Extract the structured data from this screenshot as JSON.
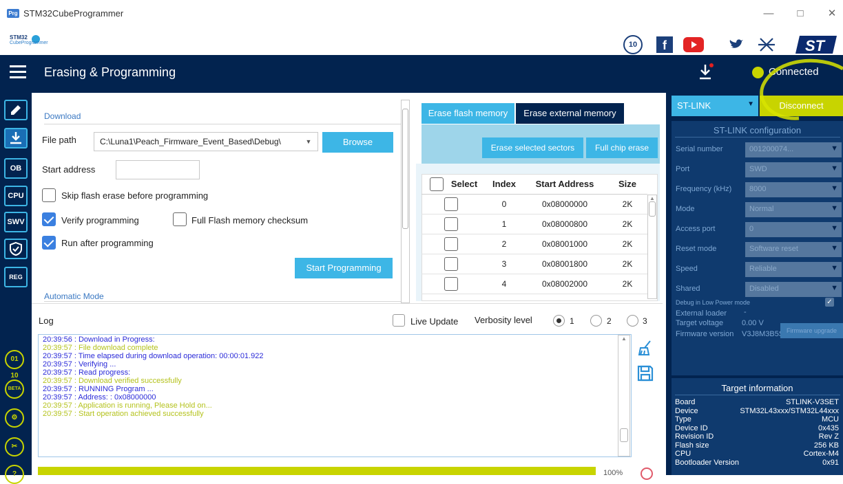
{
  "window": {
    "title": "STM32CubeProgrammer",
    "icon_label": "Prg"
  },
  "brand": {
    "line1": "STM32",
    "line2": "CubeProgrammer",
    "badge": "10"
  },
  "header": {
    "title": "Erasing & Programming",
    "status": "Connected"
  },
  "sidebar": {
    "items": [
      "OB",
      "CPU",
      "SWV",
      "REG"
    ],
    "rounds": [
      "01 10",
      "BETA",
      "",
      ""
    ]
  },
  "download": {
    "section": "Download",
    "file_path_label": "File path",
    "file_path_value": "C:\\Luna1\\Peach_Firmware_Event_Based\\Debug\\",
    "browse": "Browse",
    "start_address_label": "Start address",
    "start_address_value": "",
    "skip_erase": "Skip flash erase before programming",
    "verify": "Verify programming",
    "full_checksum": "Full Flash memory checksum",
    "run_after": "Run after programming",
    "start_btn": "Start Programming",
    "auto_mode": "Automatic Mode"
  },
  "erase": {
    "tab_flash": "Erase flash memory",
    "tab_external": "Erase external memory",
    "erase_selected": "Erase selected sectors",
    "full_chip": "Full chip erase",
    "columns": [
      "Select",
      "Index",
      "Start Address",
      "Size"
    ],
    "rows": [
      {
        "index": "0",
        "address": "0x08000000",
        "size": "2K"
      },
      {
        "index": "1",
        "address": "0x08000800",
        "size": "2K"
      },
      {
        "index": "2",
        "address": "0x08001000",
        "size": "2K"
      },
      {
        "index": "3",
        "address": "0x08001800",
        "size": "2K"
      },
      {
        "index": "4",
        "address": "0x08002000",
        "size": "2K"
      }
    ]
  },
  "log": {
    "title": "Log",
    "live_update": "Live Update",
    "verbosity": "Verbosity level",
    "levels": [
      "1",
      "2",
      "3"
    ],
    "lines": [
      {
        "text": "20:39:56 : Download in Progress:",
        "color": "#2a2ad8"
      },
      {
        "text": "20:39:57 : File download complete",
        "color": "#b4c21c"
      },
      {
        "text": "20:39:57 : Time elapsed during download operation: 00:00:01.922",
        "color": "#2a2ad8"
      },
      {
        "text": "20:39:57 : Verifying ...",
        "color": "#2a2ad8"
      },
      {
        "text": "20:39:57 : Read progress:",
        "color": "#2a2ad8"
      },
      {
        "text": "20:39:57 : Download verified successfully",
        "color": "#b4c21c"
      },
      {
        "text": "20:39:57 : RUNNING Program ...",
        "color": "#2a2ad8"
      },
      {
        "text": "20:39:57 :   Address:      : 0x08000000",
        "color": "#2a2ad8"
      },
      {
        "text": "20:39:57 : Application is running, Please Hold on...",
        "color": "#b4c21c"
      },
      {
        "text": "20:39:57 : Start operation achieved successfully",
        "color": "#b4c21c"
      }
    ]
  },
  "right": {
    "probe": "ST-LINK",
    "disconnect": "Disconnect",
    "config_title": "ST-LINK configuration",
    "fields": [
      {
        "label": "Serial number",
        "value": "001200074..."
      },
      {
        "label": "Port",
        "value": "SWD"
      },
      {
        "label": "Frequency (kHz)",
        "value": "8000"
      },
      {
        "label": "Mode",
        "value": "Normal"
      },
      {
        "label": "Access port",
        "value": "0"
      },
      {
        "label": "Reset mode",
        "value": "Software reset"
      },
      {
        "label": "Speed",
        "value": "Reliable"
      },
      {
        "label": "Shared",
        "value": "Disabled"
      }
    ],
    "debug_lp": "Debug in Low Power mode",
    "external_loader": "External loader",
    "external_loader_value": "-",
    "target_voltage": "Target voltage",
    "target_voltage_value": "0.00 V",
    "firmware_version": "Firmware version",
    "firmware_version_value": "V3J8M3B5S1",
    "firmware_upgrade": "Firmware upgrade",
    "target_title": "Target information",
    "target": [
      {
        "label": "Board",
        "value": "STLINK-V3SET"
      },
      {
        "label": "Device",
        "value": "STM32L43xxx/STM32L44xxx"
      },
      {
        "label": "Type",
        "value": "MCU"
      },
      {
        "label": "Device ID",
        "value": "0x435"
      },
      {
        "label": "Revision ID",
        "value": "Rev Z"
      },
      {
        "label": "Flash size",
        "value": "256 KB"
      },
      {
        "label": "CPU",
        "value": "Cortex-M4"
      },
      {
        "label": "Bootloader Version",
        "value": "0x91"
      }
    ]
  },
  "progress": {
    "percent_label": "100%",
    "fraction": 1.0
  },
  "colors": {
    "navy": "#02234f",
    "accent": "#3db6e6",
    "lime": "#c8d400"
  }
}
